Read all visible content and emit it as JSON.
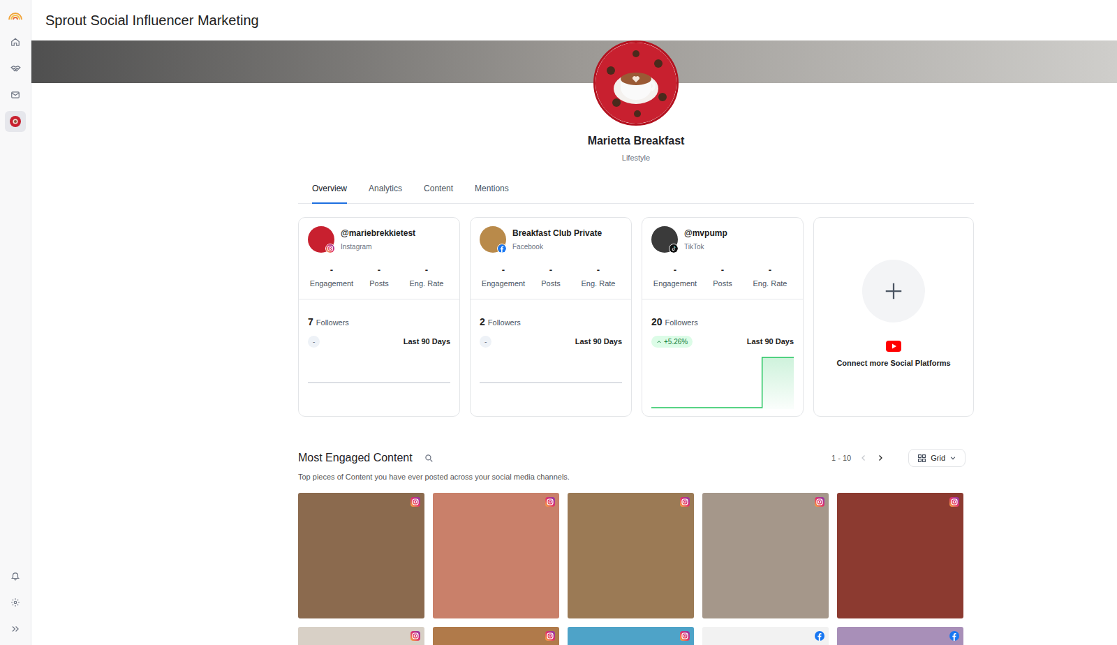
{
  "app": {
    "title": "Sprout Social Influencer Marketing"
  },
  "sidebar": {
    "items": [
      {
        "selected": false
      },
      {
        "selected": false
      },
      {
        "selected": false
      },
      {
        "selected": true
      }
    ]
  },
  "profile": {
    "name": "Marietta Breakfast",
    "category": "Lifestyle"
  },
  "tabs": [
    {
      "label": "Overview",
      "selected": true
    },
    {
      "label": "Analytics",
      "selected": false
    },
    {
      "label": "Content",
      "selected": false
    },
    {
      "label": "Mentions",
      "selected": false
    }
  ],
  "accounts": [
    {
      "handle": "@mariebrekkietest",
      "platform": "Instagram",
      "kind": "instagram",
      "stats": [
        {
          "value": "-",
          "label": "Engagement"
        },
        {
          "value": "-",
          "label": "Posts"
        },
        {
          "value": "-",
          "label": "Eng. Rate"
        }
      ],
      "followers": "7",
      "followers_label": "Followers",
      "change": "-",
      "trend": "flat",
      "period": "Last 90 Days",
      "series": [
        7,
        7,
        7,
        7,
        7,
        7,
        7,
        7,
        7,
        7
      ]
    },
    {
      "handle": "Breakfast Club Private",
      "platform": "Facebook",
      "kind": "facebook",
      "stats": [
        {
          "value": "-",
          "label": "Engagement"
        },
        {
          "value": "-",
          "label": "Posts"
        },
        {
          "value": "-",
          "label": "Eng. Rate"
        }
      ],
      "followers": "2",
      "followers_label": "Followers",
      "change": "-",
      "trend": "flat",
      "period": "Last 90 Days",
      "series": [
        2,
        2,
        2,
        2,
        2,
        2,
        2,
        2,
        2,
        2
      ]
    },
    {
      "handle": "@mvpump",
      "platform": "TikTok",
      "kind": "tiktok",
      "stats": [
        {
          "value": "-",
          "label": "Engagement"
        },
        {
          "value": "-",
          "label": "Posts"
        },
        {
          "value": "-",
          "label": "Eng. Rate"
        }
      ],
      "followers": "20",
      "followers_label": "Followers",
      "change": "+5.26%",
      "trend": "up",
      "period": "Last 90 Days",
      "series": [
        19,
        19,
        19,
        19,
        19,
        19,
        19,
        20,
        20,
        20
      ]
    }
  ],
  "connect": {
    "label": "Connect more Social Platforms"
  },
  "content": {
    "title": "Most Engaged Content",
    "subtitle": "Top pieces of Content you have ever posted across your social media channels.",
    "range": "1 - 10",
    "prev_disabled": true,
    "next_disabled": false,
    "view": "Grid",
    "items": [
      {
        "kind": "instagram"
      },
      {
        "kind": "instagram"
      },
      {
        "kind": "instagram"
      },
      {
        "kind": "instagram"
      },
      {
        "kind": "instagram"
      },
      {
        "kind": "instagram"
      },
      {
        "kind": "instagram"
      },
      {
        "kind": "instagram"
      },
      {
        "kind": "facebook"
      },
      {
        "kind": "facebook"
      }
    ]
  }
}
